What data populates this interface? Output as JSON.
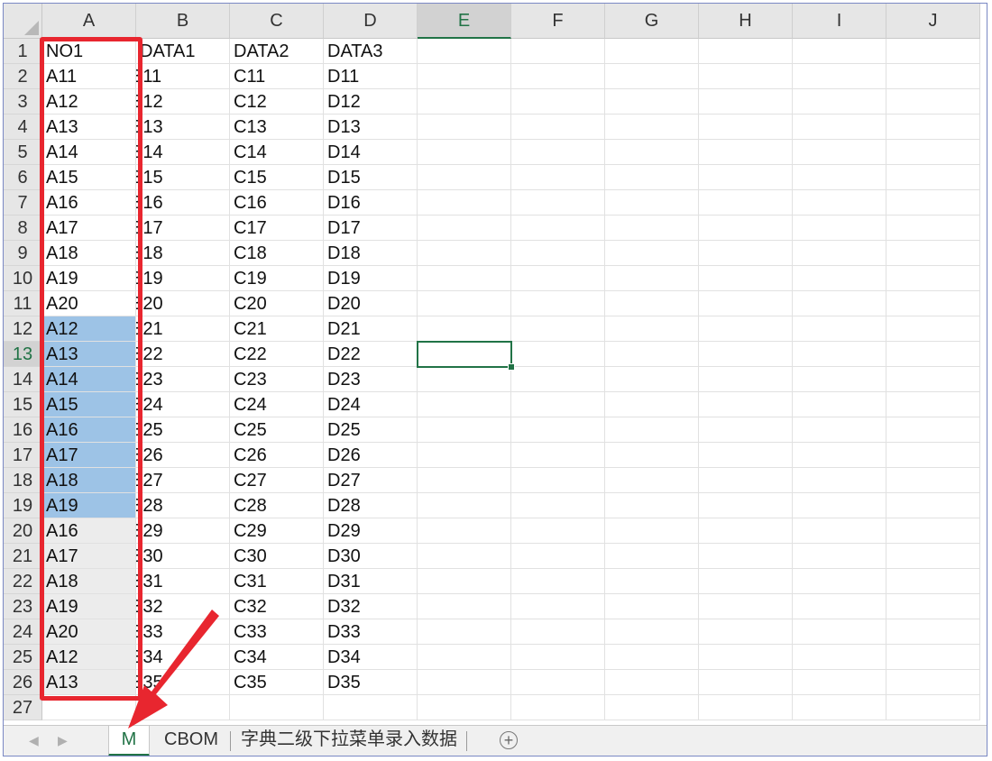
{
  "columns": [
    "A",
    "B",
    "C",
    "D",
    "E",
    "F",
    "G",
    "H",
    "I",
    "J"
  ],
  "active_column": "E",
  "active_row": "13",
  "rows": [
    {
      "num": "1",
      "A": "NO1",
      "B": "DATA1",
      "C": "DATA2",
      "D": "DATA3"
    },
    {
      "num": "2",
      "A": "A11",
      "B": "B11",
      "C": "C11",
      "D": "D11"
    },
    {
      "num": "3",
      "A": "A12",
      "B": "B12",
      "C": "C12",
      "D": "D12"
    },
    {
      "num": "4",
      "A": "A13",
      "B": "B13",
      "C": "C13",
      "D": "D13"
    },
    {
      "num": "5",
      "A": "A14",
      "B": "B14",
      "C": "C14",
      "D": "D14"
    },
    {
      "num": "6",
      "A": "A15",
      "B": "B15",
      "C": "C15",
      "D": "D15"
    },
    {
      "num": "7",
      "A": "A16",
      "B": "B16",
      "C": "C16",
      "D": "D16"
    },
    {
      "num": "8",
      "A": "A17",
      "B": "B17",
      "C": "C17",
      "D": "D17"
    },
    {
      "num": "9",
      "A": "A18",
      "B": "B18",
      "C": "C18",
      "D": "D18"
    },
    {
      "num": "10",
      "A": "A19",
      "B": "B19",
      "C": "C19",
      "D": "D19"
    },
    {
      "num": "11",
      "A": "A20",
      "B": "B20",
      "C": "C20",
      "D": "D20"
    },
    {
      "num": "12",
      "A": "A12",
      "B": "B21",
      "C": "C21",
      "D": "D21"
    },
    {
      "num": "13",
      "A": "A13",
      "B": "B22",
      "C": "C22",
      "D": "D22"
    },
    {
      "num": "14",
      "A": "A14",
      "B": "B23",
      "C": "C23",
      "D": "D23"
    },
    {
      "num": "15",
      "A": "A15",
      "B": "B24",
      "C": "C24",
      "D": "D24"
    },
    {
      "num": "16",
      "A": "A16",
      "B": "B25",
      "C": "C25",
      "D": "D25"
    },
    {
      "num": "17",
      "A": "A17",
      "B": "B26",
      "C": "C26",
      "D": "D26"
    },
    {
      "num": "18",
      "A": "A18",
      "B": "B27",
      "C": "C27",
      "D": "D27"
    },
    {
      "num": "19",
      "A": "A19",
      "B": "B28",
      "C": "C28",
      "D": "D28"
    },
    {
      "num": "20",
      "A": "A16",
      "B": "B29",
      "C": "C29",
      "D": "D29"
    },
    {
      "num": "21",
      "A": "A17",
      "B": "B30",
      "C": "C30",
      "D": "D30"
    },
    {
      "num": "22",
      "A": "A18",
      "B": "B31",
      "C": "C31",
      "D": "D31"
    },
    {
      "num": "23",
      "A": "A19",
      "B": "B32",
      "C": "C32",
      "D": "D32"
    },
    {
      "num": "24",
      "A": "A20",
      "B": "B33",
      "C": "C33",
      "D": "D33"
    },
    {
      "num": "25",
      "A": "A12",
      "B": "B34",
      "C": "C34",
      "D": "D34"
    },
    {
      "num": "26",
      "A": "A13",
      "B": "B35",
      "C": "C35",
      "D": "D35"
    },
    {
      "num": "27",
      "A": "",
      "B": "",
      "C": "",
      "D": ""
    }
  ],
  "highlight": {
    "blue_rows": [
      "12",
      "13",
      "14",
      "15",
      "16",
      "17",
      "18",
      "19"
    ],
    "grey_rows": [
      "20",
      "21",
      "22",
      "23",
      "24",
      "25",
      "26"
    ]
  },
  "sheet_tabs": [
    {
      "label": "M",
      "active": true
    },
    {
      "label": "CBOM",
      "active": false
    },
    {
      "label": "字典二级下拉菜单录入数据",
      "active": false
    }
  ],
  "icons": {
    "add_sheet": "plus-circle-icon",
    "nav_prev": "triangle-left-icon",
    "nav_next": "triangle-right-icon"
  },
  "colors": {
    "accent": "#217346",
    "selection": "#9dc3e6",
    "annotation": "#e8262f",
    "header_bg": "#e6e6e6"
  }
}
